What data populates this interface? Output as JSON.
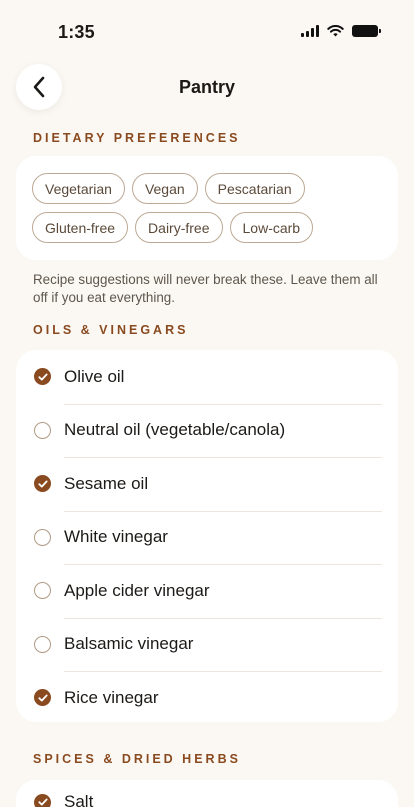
{
  "status_bar": {
    "time": "1:35"
  },
  "header": {
    "title": "Pantry",
    "back_icon": "chevron-left-icon"
  },
  "dietary": {
    "label": "DIETARY PREFERENCES",
    "chips_row1": [
      "Vegetarian",
      "Vegan",
      "Pescatarian"
    ],
    "chips_row2": [
      "Gluten-free",
      "Dairy-free",
      "Low-carb"
    ],
    "hint": "Recipe suggestions will never break these. Leave them all off if you eat everything."
  },
  "oils": {
    "label": "OILS & VINEGARS",
    "items": [
      {
        "label": "Olive oil",
        "checked": true
      },
      {
        "label": "Neutral oil (vegetable/canola)",
        "checked": false
      },
      {
        "label": "Sesame oil",
        "checked": true
      },
      {
        "label": "White vinegar",
        "checked": false
      },
      {
        "label": "Apple cider vinegar",
        "checked": false
      },
      {
        "label": "Balsamic vinegar",
        "checked": false
      },
      {
        "label": "Rice vinegar",
        "checked": true
      }
    ]
  },
  "spices": {
    "label": "SPICES & DRIED HERBS",
    "items": [
      {
        "label": "Salt",
        "checked": true
      }
    ]
  },
  "colors": {
    "accent": "#8a4a1f",
    "background": "#fbf8f4",
    "card": "#ffffff"
  }
}
